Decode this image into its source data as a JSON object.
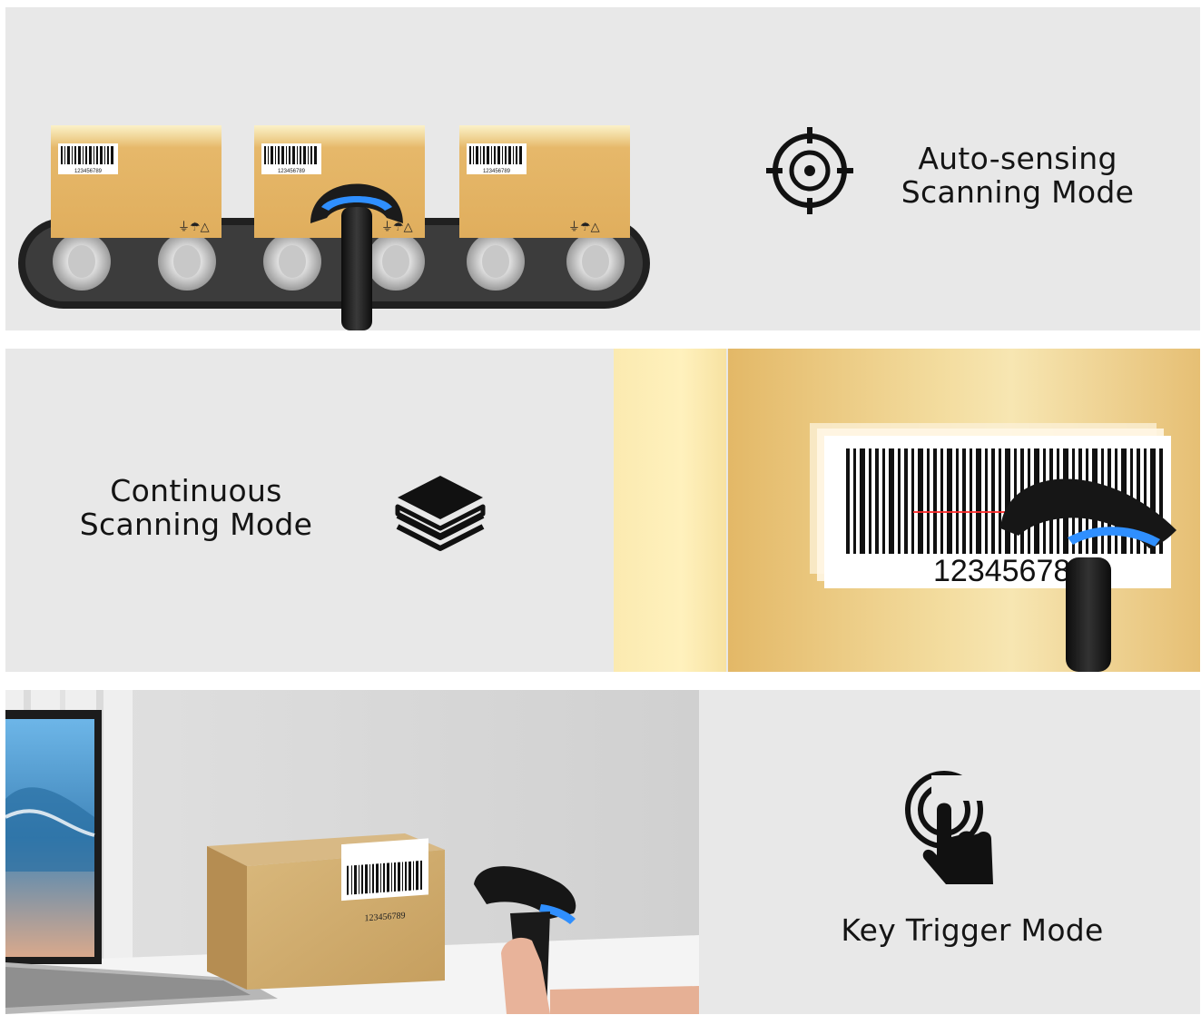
{
  "modes": [
    {
      "id": "auto",
      "line1": "Auto-sensing",
      "line2": "Scanning Mode",
      "icon": "target-crosshair-icon"
    },
    {
      "id": "continuous",
      "line1": "Continuous",
      "line2": "Scanning Mode",
      "icon": "layers-icon"
    },
    {
      "id": "trigger",
      "line1": "Key Trigger Mode",
      "icon": "touch-tap-icon"
    }
  ],
  "box_barcode_number": "123456789",
  "big_barcode_number": "12345678",
  "colors": {
    "panel_bg": "#e8e8e8",
    "box_tan": "#e4b468",
    "scanner_black": "#1a1a1a",
    "scanner_light": "#2f8fff",
    "laser_red": "#ff2a2a"
  }
}
